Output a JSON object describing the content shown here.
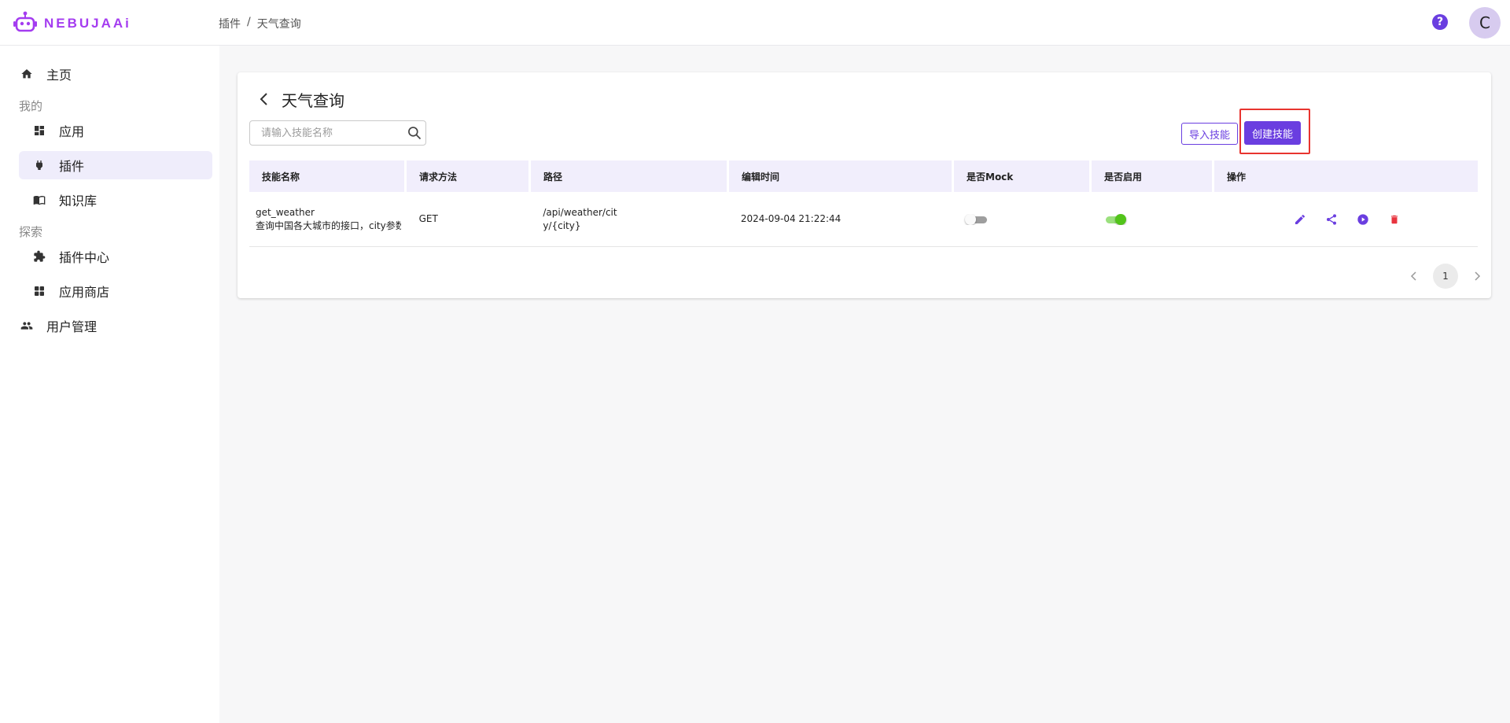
{
  "brand": {
    "name": "NEBUJAAi",
    "color": "#a43cf0"
  },
  "breadcrumb": [
    "插件",
    "天气查询"
  ],
  "breadcrumb_separator": "/",
  "header": {
    "avatar_letter": "C",
    "help_icon": "question-circle-icon"
  },
  "sidebar": {
    "home": "主页",
    "section_mine": "我的",
    "apps": "应用",
    "plugins": "插件",
    "knowledge": "知识库",
    "section_explore": "探索",
    "plugin_center": "插件中心",
    "app_store": "应用商店",
    "user_mgmt": "用户管理",
    "active_item": "插件"
  },
  "page": {
    "title": "天气查询",
    "search_placeholder": "请输入技能名称",
    "search_value": "",
    "import_button": "导入技能",
    "create_button": "创建技能",
    "accent": "#6a3ee0",
    "highlight_color": "#e8342f"
  },
  "table": {
    "headers": [
      "技能名称",
      "请求方法",
      "路径",
      "编辑时间",
      "是否Mock",
      "是否启用",
      "操作"
    ],
    "rows": [
      {
        "name": "get_weather",
        "desc": "查询中国各大城市的接口，city参数",
        "method": "GET",
        "path_line1": "/api/weather/cit",
        "path_line2": "y/{city}",
        "edited": "2024-09-04 21:22:44",
        "mock": false,
        "enabled": true,
        "actions": [
          "edit-icon",
          "share-icon",
          "play-icon",
          "delete-icon"
        ]
      }
    ]
  },
  "pagination": {
    "current_page": "1"
  }
}
